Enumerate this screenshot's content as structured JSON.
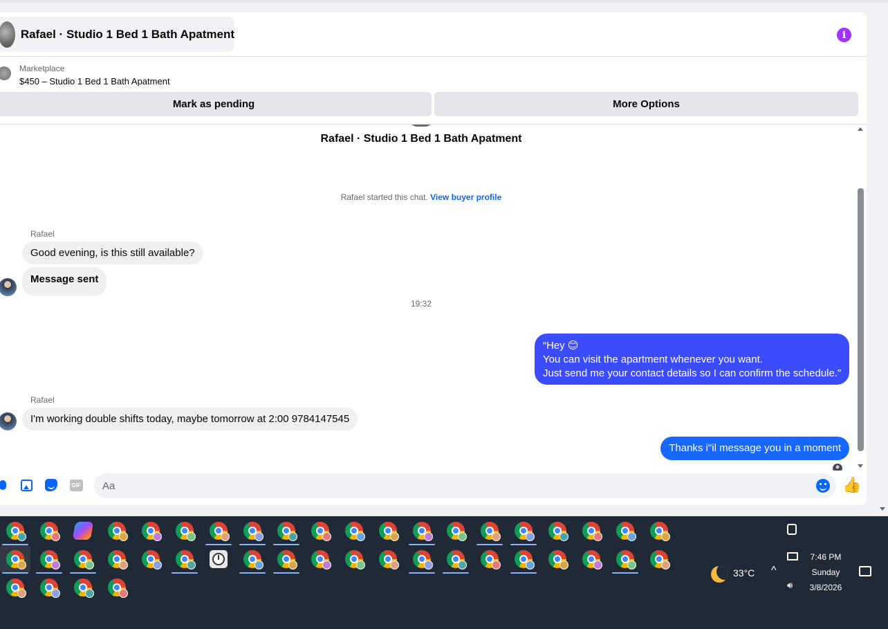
{
  "header": {
    "title": "Rafael · Studio 1 Bed 1 Bath Apatment",
    "info_icon": "info-icon"
  },
  "listing": {
    "category": "Marketplace",
    "name": "$450 – Studio 1 Bed 1 Bath Apatment",
    "mark_pending_label": "Mark as pending",
    "more_options_label": "More Options"
  },
  "chat": {
    "heading": "Rafael · Studio 1 Bed 1 Bath Apatment",
    "system_text": "Rafael started this chat.",
    "system_link": "View buyer profile",
    "messages": [
      {
        "sender": "Rafael",
        "text": "Good evening, is this still available?"
      },
      {
        "text": "Message sent"
      },
      {
        "outgoing": true,
        "lines": [
          "“Hey 😊",
          "You can visit the apartment whenever you want.",
          "Just send me your contact details so I can confirm the schedule.”"
        ]
      },
      {
        "sender": "Rafael",
        "text": "I'm working double shifts today, maybe tomorrow at 2:00   9784147545"
      },
      {
        "outgoing": true,
        "text": "Thanks i\"il message you in a moment"
      }
    ],
    "time_separator": "19:32"
  },
  "composer": {
    "placeholder": "Aa",
    "icons": [
      "mic-icon",
      "image-icon",
      "sticker-icon",
      "gif-icon",
      "emoji-icon",
      "thumbs-up-icon"
    ],
    "gif_label": "GIF",
    "like_glyph": "👍"
  },
  "taskbar": {
    "weather_temp": "33°C",
    "time": "7:46 PM",
    "day": "Sunday",
    "date": "3/8/2026",
    "colors": {
      "background": "#202a36",
      "outgoing_bubble": "#3b4cff",
      "outgoing_bubble_2": "#1668ff",
      "accent": "#0866ff"
    }
  }
}
